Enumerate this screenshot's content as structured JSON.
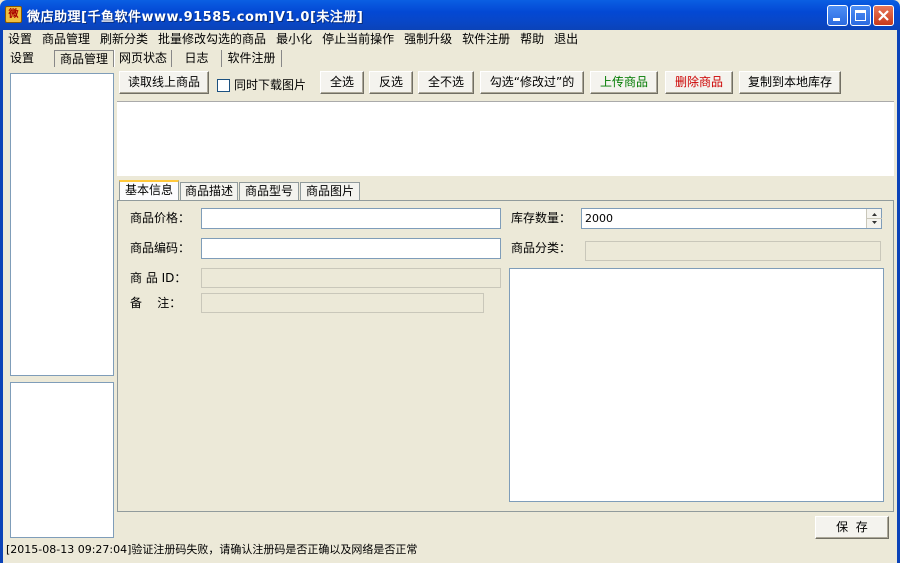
{
  "window": {
    "title": "微店助理[千鱼软件www.91585.com]V1.0[未注册]",
    "icon": "app-icon",
    "icon_glyph": "微"
  },
  "menubar": {
    "items": [
      "设置",
      "商品管理",
      "刷新分类",
      "批量修改勾选的商品",
      "最小化",
      "停止当前操作",
      "强制升级",
      "软件注册",
      "帮助",
      "退出"
    ]
  },
  "main_tabs": [
    "设置",
    "商品管理",
    "网页状态",
    "日志",
    "软件注册"
  ],
  "toolbar": {
    "read_online": "读取线上商品",
    "sync_images": "同时下载图片",
    "sync_images_checked": false,
    "select_all": "全选",
    "invert": "反选",
    "select_none": "全不选",
    "select_modified": "勾选“修改过”的",
    "upload": "上传商品",
    "delete": "删除商品",
    "copy_local": "复制到本地库存",
    "upload_color": "#007a00",
    "delete_color": "#cc0000"
  },
  "sub_tabs": [
    "基本信息",
    "商品描述",
    "商品型号",
    "商品图片"
  ],
  "form": {
    "price_label": "商品价格：",
    "price_value": "",
    "stock_label": "库存数量：",
    "stock_value": "2000",
    "code_label": "商品编码：",
    "code_value": "",
    "category_label": "商品分类：",
    "category_value": "",
    "id_label": "商 品 ID：",
    "id_value": "",
    "remark_label": "备    注：",
    "remark_value": ""
  },
  "save_button": "保  存",
  "status": "[2015-08-13 09:27:04]验证注册码失败，请确认注册码是否正确以及网络是否正常"
}
